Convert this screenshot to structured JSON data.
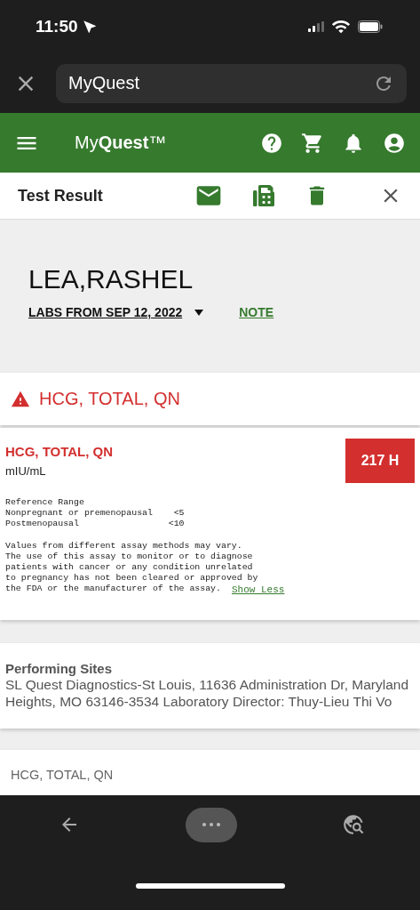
{
  "status_bar": {
    "time": "11:50"
  },
  "browser_bar": {
    "url": "MyQuest"
  },
  "app_header": {
    "logo": "My**Quest**™"
  },
  "toolbar": {
    "title": "Test Result"
  },
  "patient": {
    "name": "LEA,RASHEL",
    "labs_date": "LABS FROM SEP 12, 2022",
    "note_link": "NOTE"
  },
  "alert": {
    "title": "HCG, TOTAL, QN",
    "flagged": true
  },
  "result": {
    "test_name": "HCG, TOTAL, QN",
    "units": "mIU/mL",
    "value": "217 H",
    "abnormal": true,
    "reference_lines": [
      "Reference Range",
      "Nonpregnant or premenopausal    <5",
      "Postmenopausal                 <10"
    ],
    "comment_lines": [
      "Values from different assay methods may vary.",
      "The use of this assay to monitor or to diagnose",
      "patients with cancer or any condition unrelated",
      "to pregnancy has not been cleared or approved by",
      "the FDA or the manufacturer of the assay."
    ],
    "toggle_link": "Show Less"
  },
  "performing_sites": {
    "heading": "Performing Sites",
    "text": "SL Quest Diagnostics-St Louis, 11636 Administration Dr, Maryland Heights, MO 63146-3534 Laboratory Director: Thuy-Lieu Thi Vo"
  },
  "next_card": {
    "title": "HCG, TOTAL, QN"
  }
}
